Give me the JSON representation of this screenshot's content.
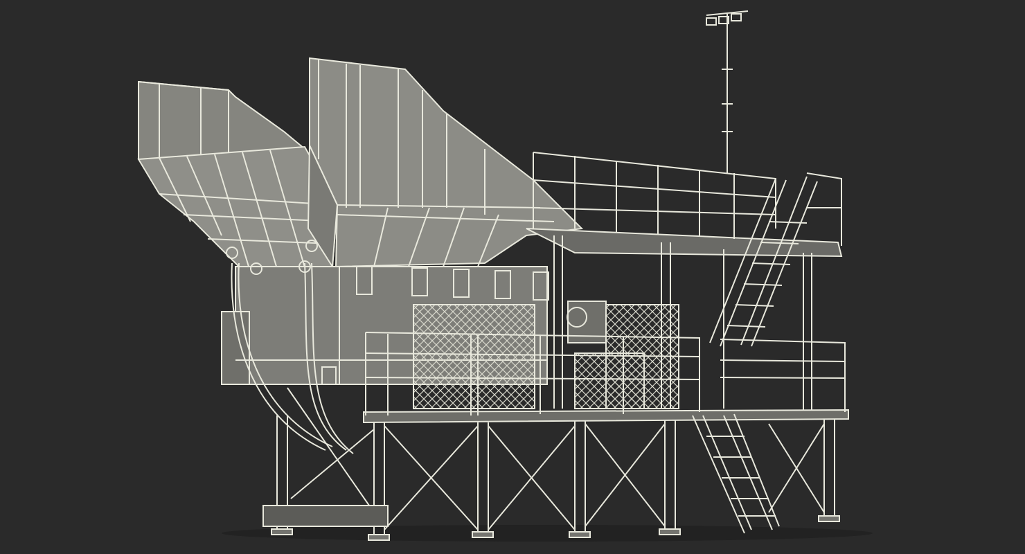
{
  "scene": {
    "subject": "wireframe-render-industrial-crushing-plant",
    "colors": {
      "background": "#2a2a2a",
      "surface": "#8c8c86",
      "surface_dark": "#74746f",
      "surface_shadow": "#5c5c58",
      "wire": "#e8e8dc",
      "wire_dim": "#c9c9bd"
    }
  }
}
